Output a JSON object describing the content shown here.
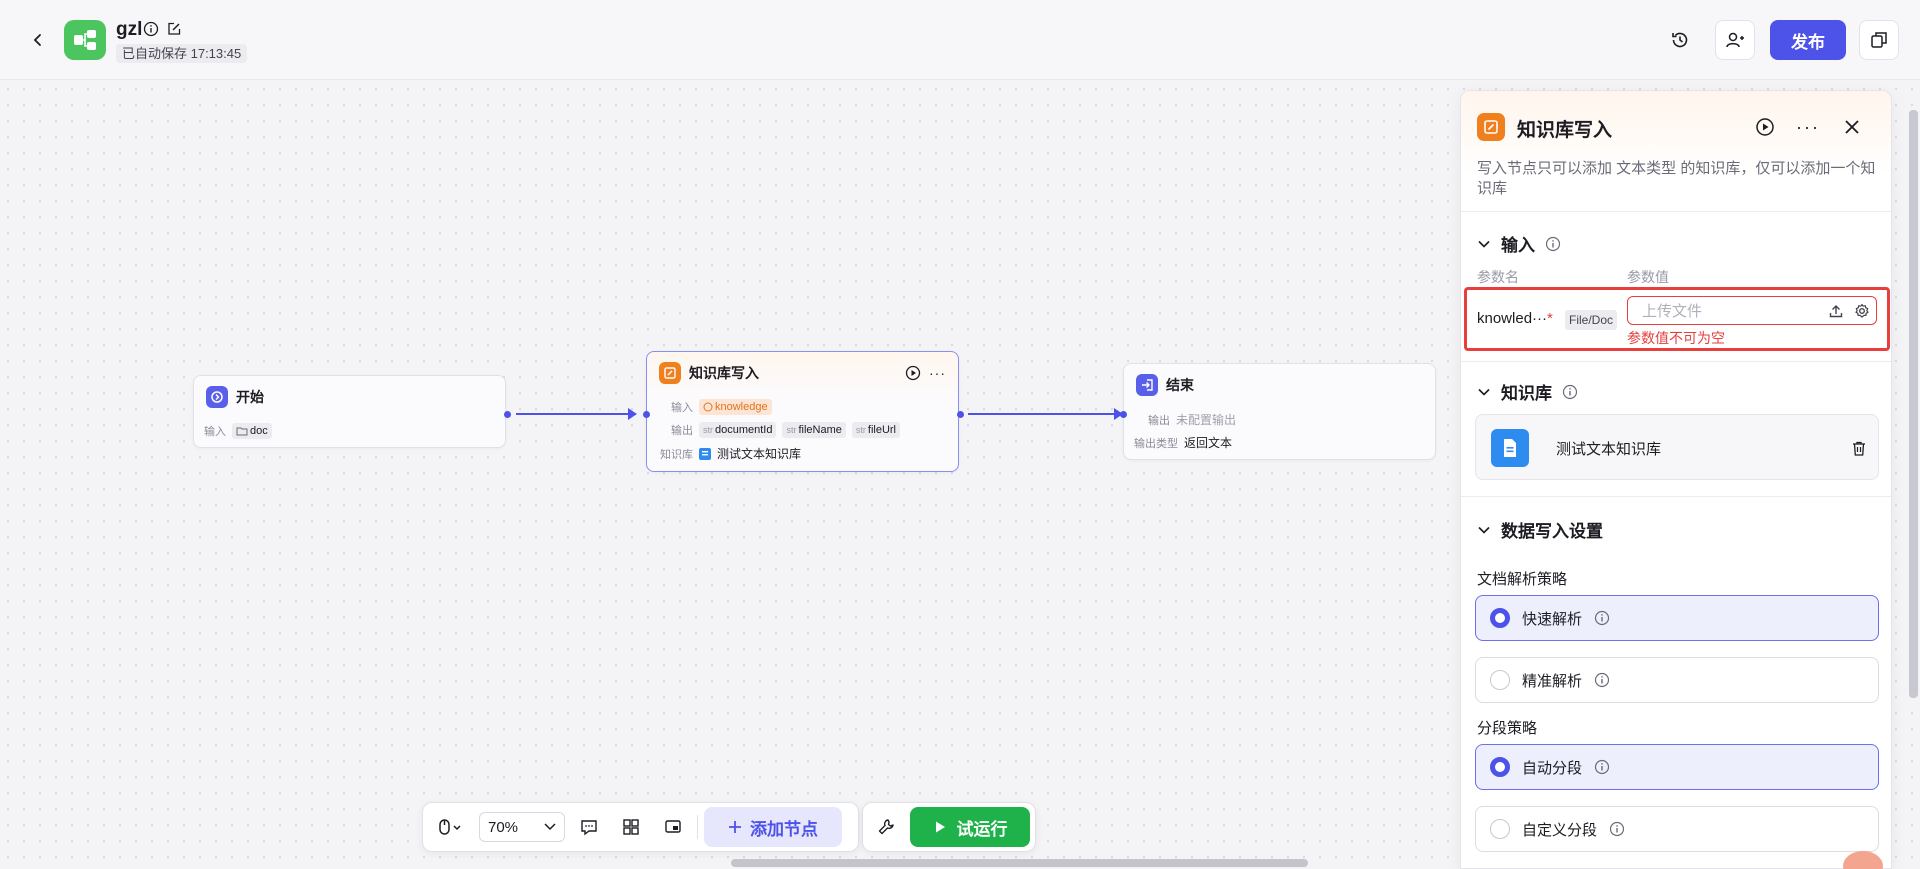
{
  "header": {
    "app_name": "gzl",
    "autosave": "已自动保存 17:13:45",
    "publish_label": "发布"
  },
  "nodes": {
    "start": {
      "title": "开始",
      "input_label": "输入",
      "input_value": "doc"
    },
    "kb_write": {
      "title": "知识库写入",
      "input_label": "输入",
      "input_value": "knowledge",
      "output_label": "输出",
      "outputs": [
        {
          "type": "str",
          "name": "documentId"
        },
        {
          "type": "str",
          "name": "fileName"
        },
        {
          "type": "str",
          "name": "fileUrl"
        }
      ],
      "kb_label": "知识库",
      "kb_value": "测试文本知识库"
    },
    "end": {
      "title": "结束",
      "output_label": "输出",
      "output_value": "未配置输出",
      "output_type_label": "输出类型",
      "output_type_value": "返回文本"
    }
  },
  "toolbar": {
    "zoom": "70%",
    "add_node_label": "添加节点",
    "run_label": "试运行"
  },
  "panel": {
    "title": "知识库写入",
    "description": "写入节点只可以添加 文本类型 的知识库，仅可以添加一个知识库",
    "input_section": {
      "title": "输入",
      "col_name": "参数名",
      "col_value": "参数值",
      "param_name": "knowled···",
      "required_mark": "*",
      "param_type": "File/Doc",
      "placeholder": "上传文件",
      "error": "参数值不可为空"
    },
    "kb_section": {
      "title": "知识库",
      "item_name": "测试文本知识库"
    },
    "write_section": {
      "title": "数据写入设置",
      "parse_label": "文档解析策略",
      "parse_options": [
        {
          "label": "快速解析",
          "selected": true
        },
        {
          "label": "精准解析",
          "selected": false
        }
      ],
      "chunk_label": "分段策略",
      "chunk_options": [
        {
          "label": "自动分段",
          "selected": true
        },
        {
          "label": "自定义分段",
          "selected": false
        }
      ]
    }
  },
  "colors": {
    "accent": "#4d53e8",
    "run": "#1fb24a",
    "error": "#e73e3e",
    "kb_node": "#f07f1e",
    "app_logo": "#4cc55f"
  }
}
